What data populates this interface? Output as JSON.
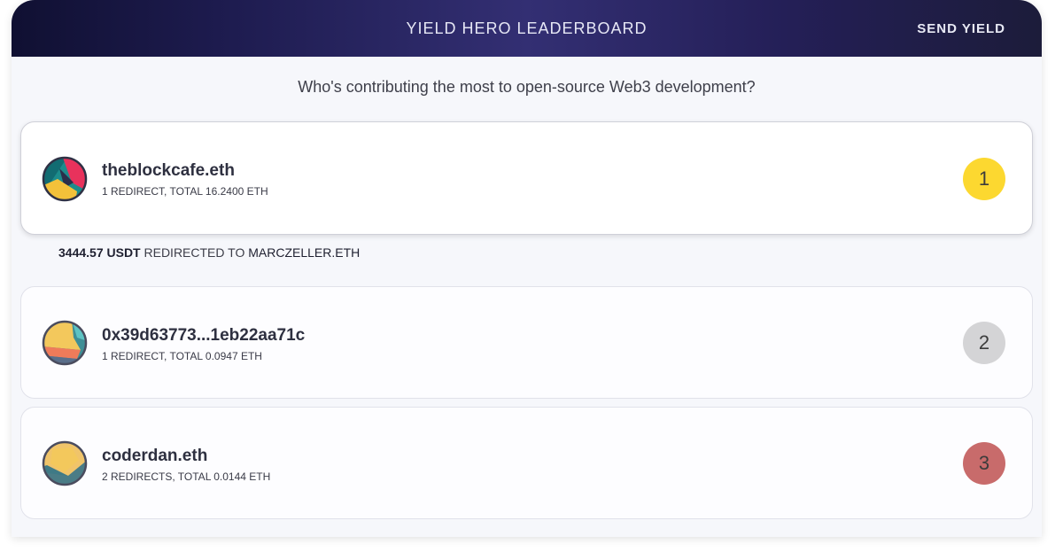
{
  "header": {
    "title": "YIELD HERO LEADERBOARD",
    "send_label": "SEND YIELD"
  },
  "subtitle": "Who's contributing the most to open-source Web3 development?",
  "leaders": [
    {
      "name": "theblockcafe.eth",
      "meta": "1 REDIRECT, TOTAL 16.2400 ETH",
      "rank": "1",
      "rank_color": "#fcd830",
      "avatar_icon": "geometric-avatar-icon"
    },
    {
      "name": "0x39d63773...1eb22aa71c",
      "meta": "1 REDIRECT, TOTAL 0.0947 ETH",
      "rank": "2",
      "rank_color": "#d4d4d6",
      "avatar_icon": "geometric-avatar-icon"
    },
    {
      "name": "coderdan.eth",
      "meta": "2 REDIRECTS, TOTAL 0.0144 ETH",
      "rank": "3",
      "rank_color": "#c86b6b",
      "avatar_icon": "geometric-avatar-icon"
    }
  ],
  "expanded_detail": {
    "amount": "3444.57 USDT",
    "redirected_label": "REDIRECTED TO",
    "recipient": "MARCZELLER.ETH"
  },
  "colors": {
    "background": "#f6f7fb",
    "header_gradient_start": "#101032",
    "header_gradient_mid": "#332f73"
  }
}
